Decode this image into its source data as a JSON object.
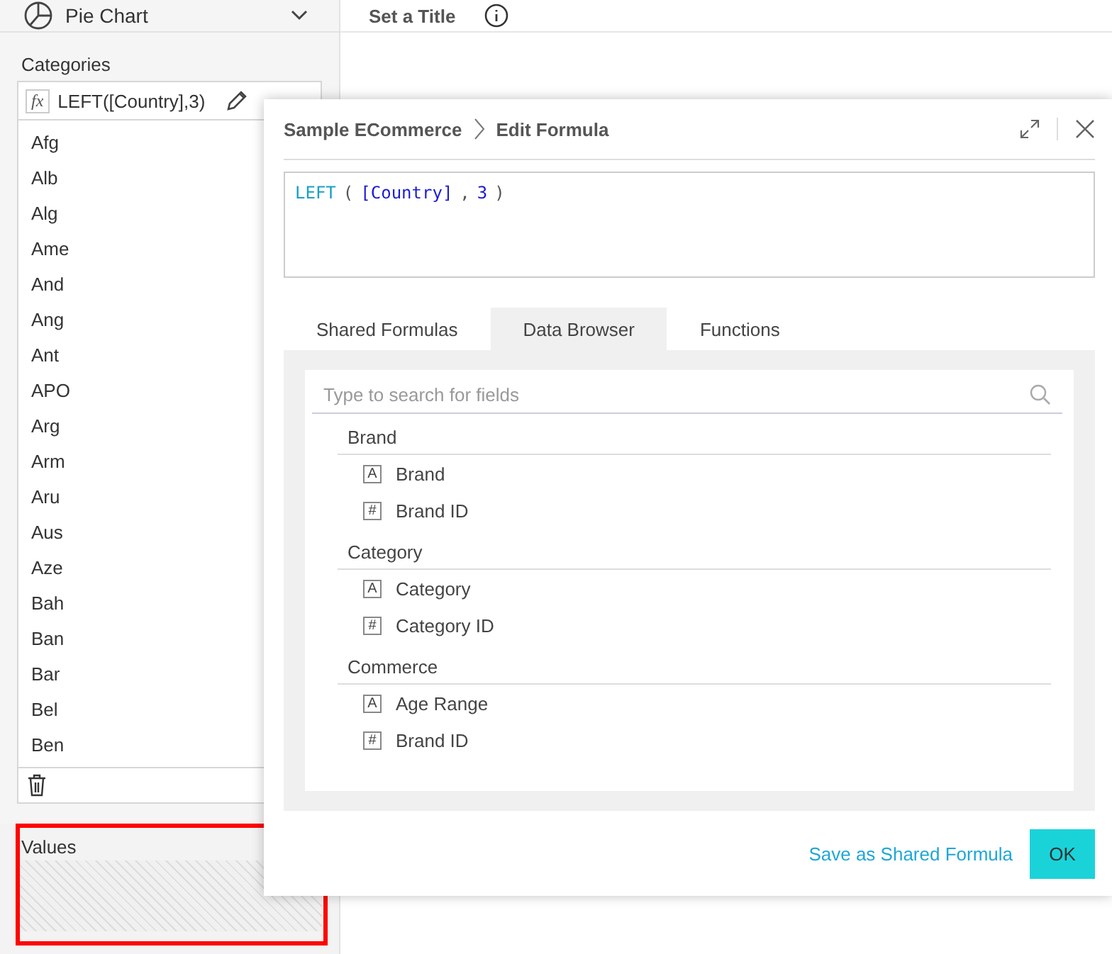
{
  "chart_type": {
    "label": "Pie Chart"
  },
  "title_bar": {
    "title": "Set a Title"
  },
  "categories": {
    "label": "Categories",
    "formula_badge": "fx",
    "formula": "LEFT([Country],3)",
    "items": [
      "Afg",
      "Alb",
      "Alg",
      "Ame",
      "And",
      "Ang",
      "Ant",
      "APO",
      "Arg",
      "Arm",
      "Aru",
      "Aus",
      "Aze",
      "Bah",
      "Ban",
      "Bar",
      "Bel",
      "Ben"
    ]
  },
  "values": {
    "label": "Values"
  },
  "dialog": {
    "breadcrumb": [
      "Sample ECommerce",
      "Edit Formula"
    ],
    "formula_tokens": [
      {
        "kind": "function",
        "text": "LEFT"
      },
      {
        "kind": "punct",
        "text": "("
      },
      {
        "kind": "field",
        "text": "[Country]"
      },
      {
        "kind": "punct",
        "text": ","
      },
      {
        "kind": "number",
        "text": "3"
      },
      {
        "kind": "punct",
        "text": ")"
      }
    ],
    "tabs": [
      {
        "label": "Shared Formulas",
        "selected": false
      },
      {
        "label": "Data Browser",
        "selected": true
      },
      {
        "label": "Functions",
        "selected": false
      }
    ],
    "search": {
      "placeholder": "Type to search for fields"
    },
    "groups": [
      {
        "name": "Brand",
        "fields": [
          {
            "glyph": "A",
            "name": "Brand"
          },
          {
            "glyph": "#",
            "name": "Brand ID"
          }
        ]
      },
      {
        "name": "Category",
        "fields": [
          {
            "glyph": "A",
            "name": "Category"
          },
          {
            "glyph": "#",
            "name": "Category ID"
          }
        ]
      },
      {
        "name": "Commerce",
        "fields": [
          {
            "glyph": "A",
            "name": "Age Range"
          },
          {
            "glyph": "#",
            "name": "Brand ID"
          }
        ]
      }
    ],
    "save_link": "Save as Shared Formula",
    "ok_button": "OK"
  }
}
